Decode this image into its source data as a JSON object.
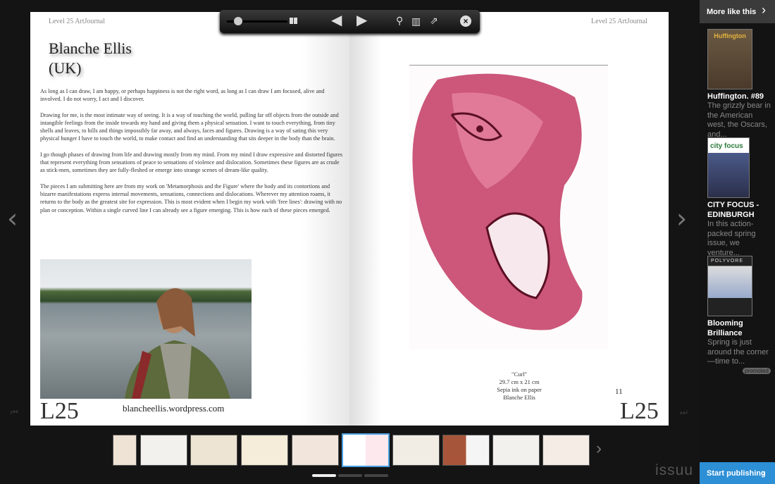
{
  "left_page": {
    "running_head": "Level 25 ArtJournal",
    "title_line1": "Blanche Ellis",
    "title_line2": "(UK)",
    "paragraphs": [
      "As long as I can draw, I am happy, or perhaps happiness is not the right word, as long as I can draw I am focused, alive and involved. I do not worry, I act and I discover.",
      "Drawing for me, is the most intimate way of seeing. It is a way of touching the world, pulling far off objects from the outside and intangible feelings from the inside towards my hand and giving them a physical sensation. I want to touch everything, from tiny shells and leaves, to hills and things impossibly far away, and always, faces and figures. Drawing is a way of sating this very physical hunger I have to touch the world, to make contact and find an understanding that sits deeper in the body than the brain.",
      "I go though phases of drawing from life and drawing mostly from my mind. From my mind I draw expressive and distorted figures that represent everything from sensations of peace to sensations of violence and dislocation. Sometimes these figures are as crude as stick-men, sometimes they are fully-fleshed or emerge into strange scenes of dream-like quality.",
      "The pieces I am submitting here are from my work on 'Metamorphosis and the Figure' where the body and its contortions and bizarre manifestations express internal movements, sensations, connections and dislocations. Wherever my attention roams, it returns to the body as the greatest site for expression. This is most evident when I begin my work with 'free lines': drawing with no plan or conception. Within a single curved line I can already see a figure emerging. This is how each of these pieces emerged."
    ],
    "logo": "L25",
    "url": "blancheellis.wordpress.com"
  },
  "right_page": {
    "running_head": "Level 25 ArtJournal",
    "caption": [
      "\"Curl\"",
      "29.7 cm x 21 cm",
      "Sepia ink on paper",
      "Blanche Ellis"
    ],
    "page_number": "11",
    "logo": "L25"
  },
  "toolbar": {
    "zoom_level": 0.1,
    "icons": [
      "zoom-slider",
      "two-page-icon",
      "previous-page-icon",
      "next-page-icon",
      "search-icon",
      "contents-icon",
      "share-icon",
      "close-icon"
    ]
  },
  "thumbnails": {
    "count": 10,
    "selected_index": 5
  },
  "pager": {
    "pages": 3,
    "active": 0
  },
  "sidebar": {
    "header": "More like this",
    "items": [
      {
        "title": "Huffington. #89",
        "desc": "The grizzly bear in the American west, the Oscars, and..."
      },
      {
        "title": "CITY FOCUS - EDINBURGH",
        "desc": "In this action-packed spring issue, we venture..."
      },
      {
        "title": "Blooming Brilliance",
        "desc": "Spring is just around the corner—time to...",
        "badge": "promoted"
      }
    ],
    "cover_labels": [
      "Huffington",
      "city focus",
      "POLYVORE"
    ]
  },
  "brand": "issuu",
  "publish_button": "Start publishing",
  "colors": {
    "accent": "#2d8fd5",
    "ink": "#b8264f"
  }
}
